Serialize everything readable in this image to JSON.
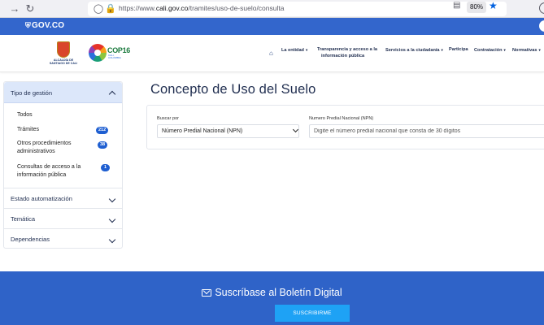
{
  "browser": {
    "url_prefix": "https://www.",
    "url_host": "cali.gov.co",
    "url_path": "/tramites/uso-de-suelo/consulta",
    "zoom": "80%"
  },
  "gov_bar": {
    "logo": "GOV.CO"
  },
  "header": {
    "alcaldia_text": "ALCALDÍA DE SANTIAGO DE CALI",
    "cop_text": "COP16",
    "cop_sub": "CALI, COLOMBIA",
    "nav": [
      {
        "label": "La entidad",
        "has_caret": true
      },
      {
        "label": "Transparencia y acceso a la",
        "label2": "información pública"
      },
      {
        "label": "Servicios a la ciudadanía",
        "has_caret": true
      },
      {
        "label": "Participa"
      },
      {
        "label": "Contratación",
        "has_caret": true
      },
      {
        "label": "Normativas",
        "has_caret": true
      }
    ]
  },
  "sidebar": {
    "header": "Tipo de gestión",
    "items": [
      {
        "label": "Todos"
      },
      {
        "label": "Trámites",
        "count": "212"
      },
      {
        "label": "Otros procedimientos administrativos",
        "count": "38"
      },
      {
        "label": "Consultas de acceso a la información pública",
        "count": "1"
      }
    ],
    "sections": [
      "Estado automatización",
      "Temática",
      "Dependencias"
    ]
  },
  "main": {
    "title": "Concepto de Uso del Suelo",
    "buscar_label": "Buscar por",
    "buscar_value": "Número Predial Nacional (NPN)",
    "npn_label": "Numero Predial Nacional (NPN)",
    "npn_placeholder": "Digite el número predial nacional que consta de 30 dígitos"
  },
  "footer": {
    "title": "Suscríbase al Boletín Digital",
    "button": "SUSCRIBIRME"
  },
  "colors": {
    "gov_blue": "#3366cc",
    "footer_blue": "#2f63c8",
    "badge_blue": "#1f5fd1",
    "button_blue": "#1ea2f5"
  }
}
